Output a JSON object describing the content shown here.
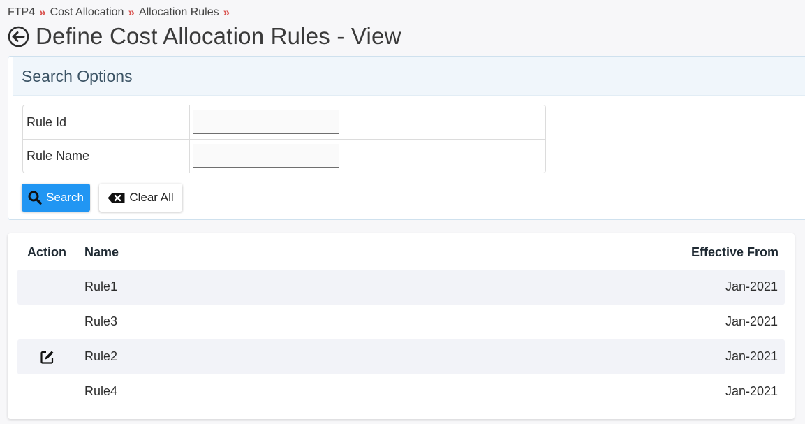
{
  "breadcrumb": {
    "items": [
      "FTP4",
      "Cost Allocation",
      "Allocation Rules"
    ],
    "separator": "»"
  },
  "header": {
    "title": "Define Cost Allocation Rules - View",
    "back_icon": "back-arrow-circle-icon"
  },
  "search": {
    "title": "Search Options",
    "fields": [
      {
        "label": "Rule Id",
        "value": "",
        "placeholder": ""
      },
      {
        "label": "Rule Name",
        "value": "",
        "placeholder": ""
      }
    ],
    "search_label": "Search",
    "clear_label": "Clear All",
    "search_icon": "search-icon",
    "clear_icon": "backspace-icon"
  },
  "table": {
    "headers": {
      "action": "Action",
      "name": "Name",
      "effective_from": "Effective From"
    },
    "rows": [
      {
        "name": "Rule1",
        "effective_from": "Jan-2021",
        "has_edit": false
      },
      {
        "name": "Rule3",
        "effective_from": "Jan-2021",
        "has_edit": false
      },
      {
        "name": "Rule2",
        "effective_from": "Jan-2021",
        "has_edit": true
      },
      {
        "name": "Rule4",
        "effective_from": "Jan-2021",
        "has_edit": false
      }
    ]
  },
  "colors": {
    "accent": "#2196f3",
    "separator": "#d9534f",
    "panel_header_bg": "#f0f6fb",
    "row_shade": "#f2f3f8"
  }
}
